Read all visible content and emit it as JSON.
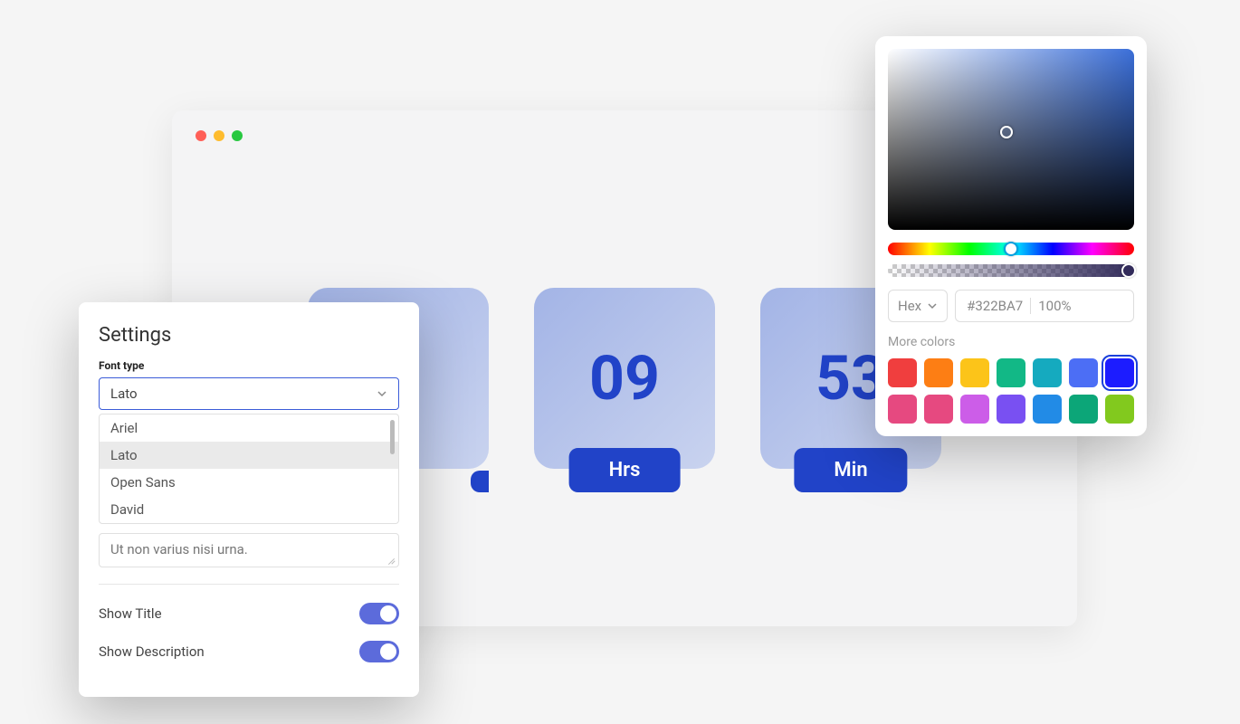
{
  "countdown": {
    "cards": [
      {
        "value": "",
        "label": ""
      },
      {
        "value": "09",
        "label": "Hrs"
      },
      {
        "value": "53",
        "label": "Min"
      }
    ]
  },
  "settings": {
    "title": "Settings",
    "font_type_label": "Font type",
    "font_selected": "Lato",
    "font_options": [
      "Ariel",
      "Lato",
      "Open Sans",
      "David"
    ],
    "textarea_value": "Ut non varius nisi urna.",
    "toggles": [
      {
        "label": "Show Title",
        "on": true
      },
      {
        "label": "Show Description",
        "on": true
      }
    ]
  },
  "picker": {
    "format": "Hex",
    "hex": "#322BA7",
    "opacity": "100%",
    "more_label": "More colors",
    "swatches": [
      "#f03e3e",
      "#fd7e14",
      "#fcc419",
      "#12b886",
      "#15aabf",
      "#4c6ef5",
      "#1c1cff",
      "#e64980",
      "#e64980",
      "#cc5de8",
      "#7950f2",
      "#228be6",
      "#0ca678",
      "#82c91e"
    ],
    "selected_index": 6
  }
}
